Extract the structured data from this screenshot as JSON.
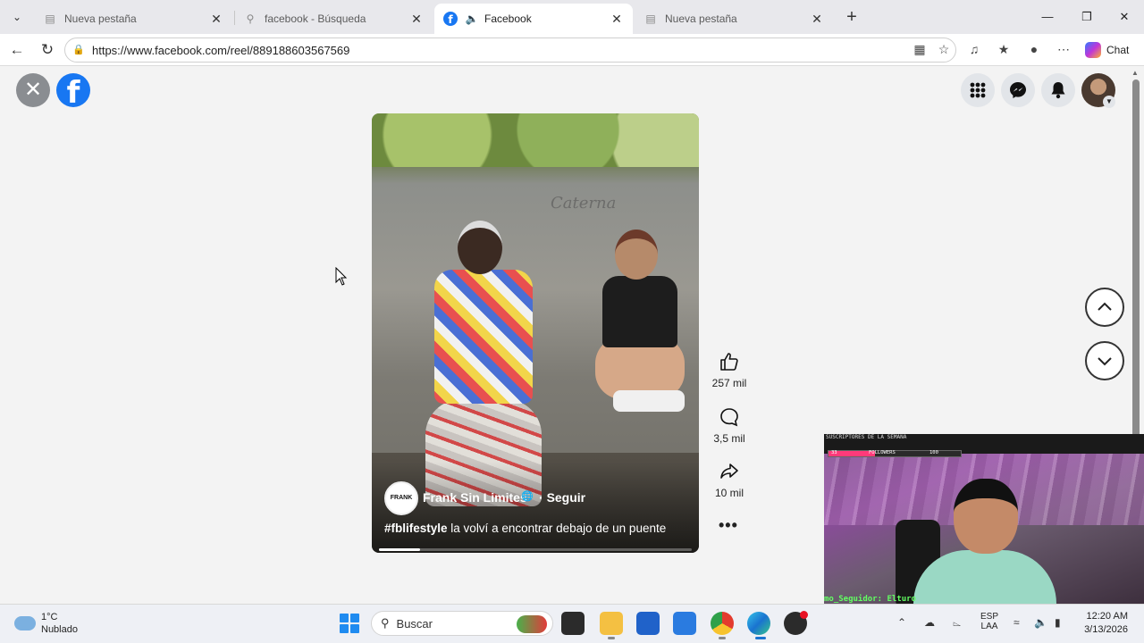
{
  "browser": {
    "tabs": [
      {
        "title": "Nueva pestaña",
        "icon": "page-icon",
        "active": false
      },
      {
        "title": "facebook - Búsqueda",
        "icon": "search-icon",
        "active": false
      },
      {
        "title": "Facebook",
        "icon": "facebook-icon",
        "active": true,
        "audio": true
      },
      {
        "title": "Nueva pestaña",
        "icon": "page-icon",
        "active": false
      }
    ],
    "url": "https://www.facebook.com/reel/889188603567569",
    "chat_label": "Chat",
    "accent": "#1877f2"
  },
  "reel": {
    "author": "Frank Sin Limites",
    "author_avatar_text": "FRANK",
    "follow_label": "Seguir",
    "caption_hashtag": "#fblifestyle",
    "caption_text": "la volví a encontrar debajo de un puente",
    "progress": 0.13,
    "graffiti": "Caterna",
    "actions": {
      "likes": "257 mil",
      "comments": "3,5 mil",
      "shares": "10 mil"
    }
  },
  "webcam": {
    "top_text": "SUSCRIPTORES DE LA SEMANA",
    "followers_label": "FOLLOWERS",
    "followers_count": "100",
    "followers_current": "33",
    "bottom_text": "mo_Seguidor: Elturo"
  },
  "taskbar": {
    "temperature": "1°C",
    "condition": "Nublado",
    "search_placeholder": "Buscar",
    "language": "ESP",
    "layout": "LAA",
    "time": "12:20 AM",
    "date": "3/13/2026"
  }
}
